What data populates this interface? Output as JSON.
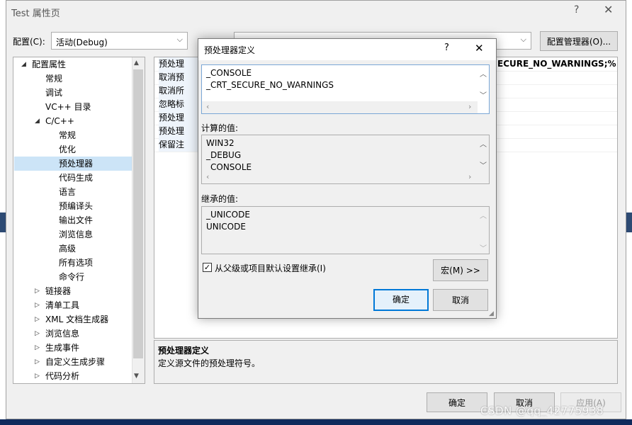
{
  "window": {
    "title": "Test 属性页",
    "help": "?",
    "close": "✕"
  },
  "config_bar": {
    "config_label": "配置(C):",
    "config_value": "活动(Debug)",
    "manager_button": "配置管理器(O)..."
  },
  "tree": {
    "items": [
      {
        "label": "配置属性",
        "expander": "◢"
      },
      {
        "label": "常规"
      },
      {
        "label": "调试"
      },
      {
        "label": "VC++ 目录"
      },
      {
        "label": "C/C++",
        "expander": "◢"
      },
      {
        "label": "常规"
      },
      {
        "label": "优化"
      },
      {
        "label": "预处理器"
      },
      {
        "label": "代码生成"
      },
      {
        "label": "语言"
      },
      {
        "label": "预编译头"
      },
      {
        "label": "输出文件"
      },
      {
        "label": "浏览信息"
      },
      {
        "label": "高级"
      },
      {
        "label": "所有选项"
      },
      {
        "label": "命令行"
      },
      {
        "label": "链接器",
        "expander": "▷"
      },
      {
        "label": "清单工具",
        "expander": "▷"
      },
      {
        "label": "XML 文档生成器",
        "expander": "▷"
      },
      {
        "label": "浏览信息",
        "expander": "▷"
      },
      {
        "label": "生成事件",
        "expander": "▷"
      },
      {
        "label": "自定义生成步骤",
        "expander": "▷"
      },
      {
        "label": "代码分析",
        "expander": "▷"
      }
    ],
    "scroll_up": "▲",
    "scroll_down": "▼"
  },
  "grid": {
    "rows": [
      {
        "name": "预处理",
        "value": "ECURE_NO_WARNINGS;%(Pre"
      },
      {
        "name": "取消预",
        "value": ""
      },
      {
        "name": "取消所",
        "value": ""
      },
      {
        "name": "忽略标",
        "value": ""
      },
      {
        "name": "预处理",
        "value": ""
      },
      {
        "name": "预处理",
        "value": ""
      },
      {
        "name": "保留注",
        "value": ""
      }
    ]
  },
  "description": {
    "title": "预处理器定义",
    "text": "定义源文件的预处理符号。"
  },
  "footer": {
    "ok": "确定",
    "cancel": "取消",
    "apply": "应用(A)"
  },
  "dialog": {
    "title": "预处理器定义",
    "help": "?",
    "close": "✕",
    "definitions": [
      "_CONSOLE",
      "_CRT_SECURE_NO_WARNINGS"
    ],
    "computed_label": "计算的值:",
    "computed": [
      "WIN32",
      "_DEBUG",
      "_CONSOLE"
    ],
    "inherited_label": "继承的值:",
    "inherited": [
      "_UNICODE",
      "UNICODE"
    ],
    "inherit_checkbox": "从父级或项目默认设置继承(I)",
    "inherit_checked": "✓",
    "macro_button": "宏(M) >>",
    "ok": "确定",
    "cancel": "取消",
    "resize_grip": "◢"
  },
  "watermark": "CSDN @qq_42775938"
}
